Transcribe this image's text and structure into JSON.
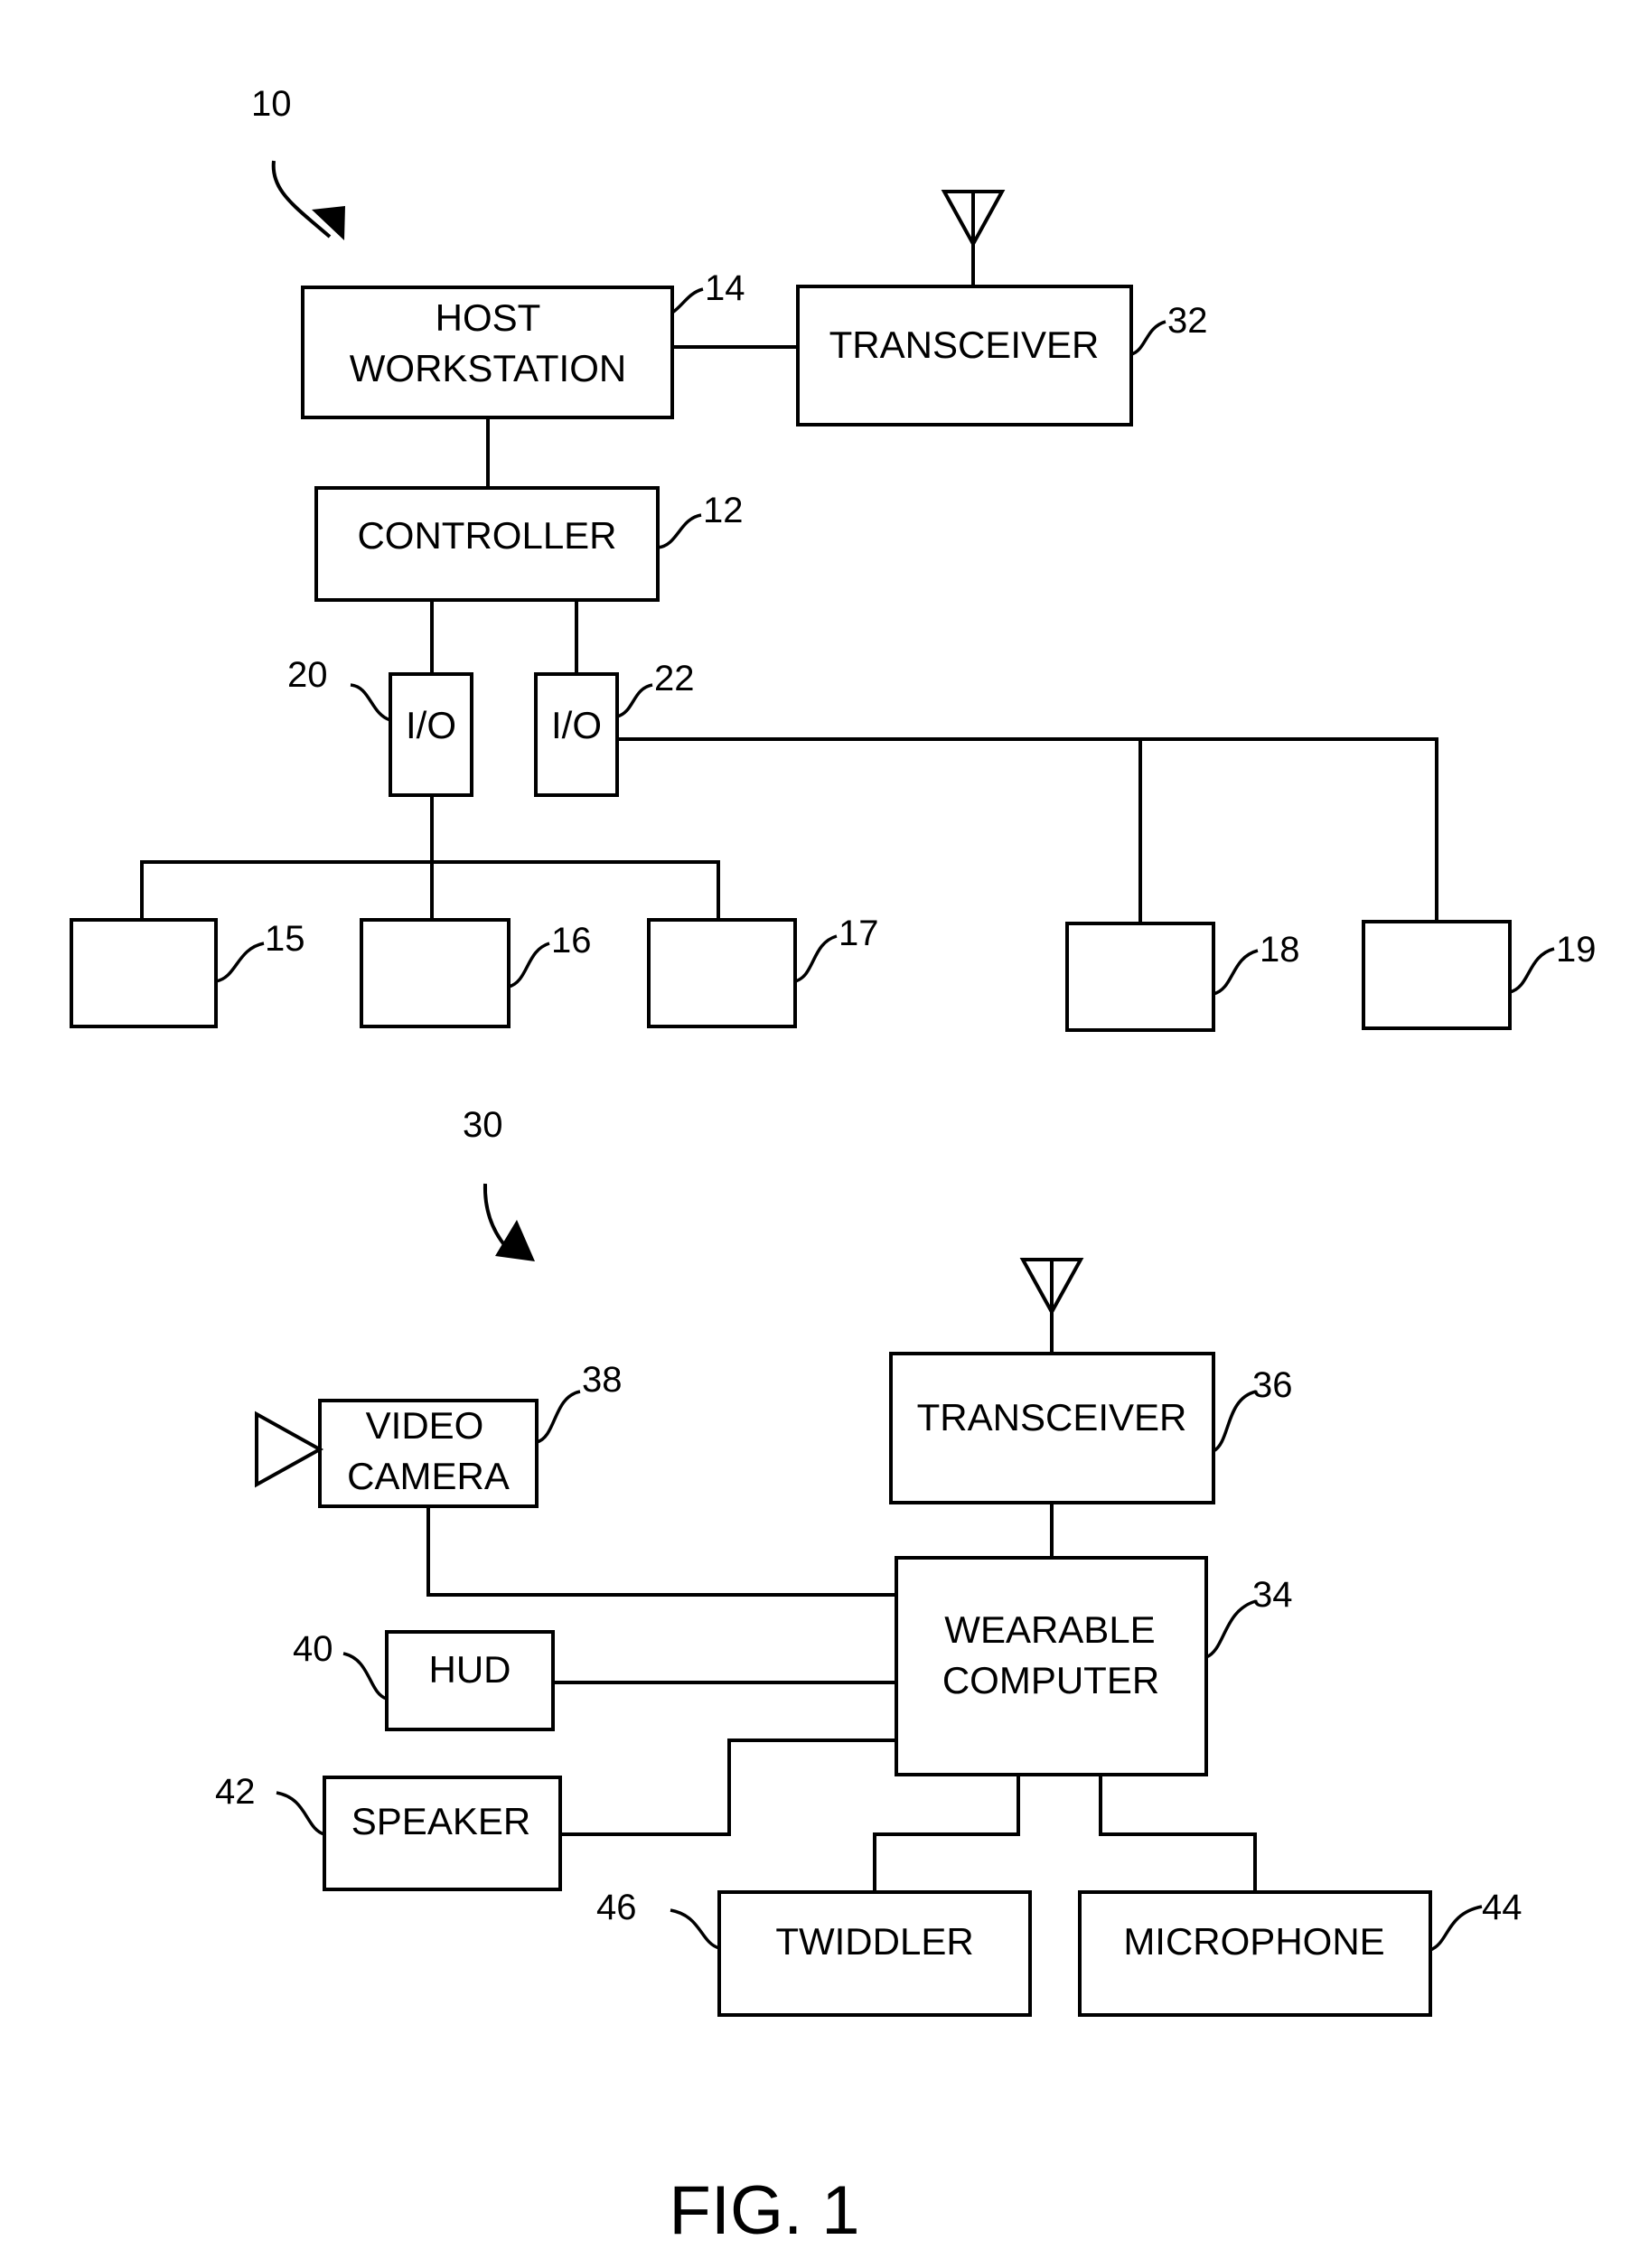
{
  "figure": {
    "caption": "FIG. 1",
    "systems": [
      {
        "ref": "10"
      },
      {
        "ref": "30"
      }
    ]
  },
  "blocks": {
    "host_workstation": {
      "line1": "HOST",
      "line2": "WORKSTATION",
      "ref": "14"
    },
    "transceiver_32": {
      "label": "TRANSCEIVER",
      "ref": "32"
    },
    "controller": {
      "label": "CONTROLLER",
      "ref": "12"
    },
    "io_20": {
      "label": "I/O",
      "ref": "20"
    },
    "io_22": {
      "label": "I/O",
      "ref": "22"
    },
    "device_15": {
      "ref": "15"
    },
    "device_16": {
      "ref": "16"
    },
    "device_17": {
      "ref": "17"
    },
    "device_18": {
      "ref": "18"
    },
    "device_19": {
      "ref": "19"
    },
    "video_camera": {
      "line1": "VIDEO",
      "line2": "CAMERA",
      "ref": "38"
    },
    "transceiver_36": {
      "label": "TRANSCEIVER",
      "ref": "36"
    },
    "wearable_computer": {
      "line1": "WEARABLE",
      "line2": "COMPUTER",
      "ref": "34"
    },
    "hud": {
      "label": "HUD",
      "ref": "40"
    },
    "speaker": {
      "label": "SPEAKER",
      "ref": "42"
    },
    "twiddler": {
      "label": "TWIDDLER",
      "ref": "46"
    },
    "microphone": {
      "label": "MICROPHONE",
      "ref": "44"
    }
  }
}
